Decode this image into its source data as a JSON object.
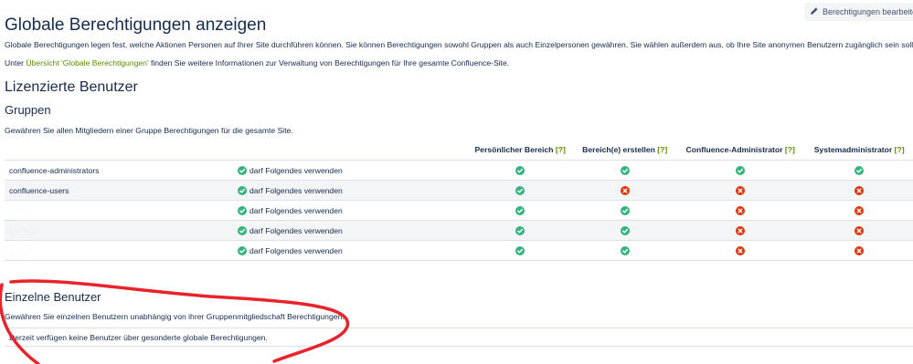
{
  "page": {
    "title": "Globale Berechtigungen anzeigen",
    "edit_button": "Berechtigungen bearbeiten",
    "intro": "Globale Berechtigungen legen fest, welche Aktionen Personen auf Ihrer Site durchführen können. Sie können Berechtigungen sowohl Gruppen als auch Einzelpersonen gewähren. Sie wählen außerdem aus, ob Ihre Site anonymen Benutzern zugänglich sein soll.",
    "intro2_prefix": "Unter ",
    "intro2_link": "Übersicht 'Globale Berechtigungen'",
    "intro2_suffix": " finden Sie weitere Informationen zur Verwaltung von Berechtigungen für Ihre gesamte Confluence-Site."
  },
  "licensed": {
    "heading": "Lizenzierte Benutzer",
    "groups_heading": "Gruppen",
    "groups_desc": "Gewähren Sie allen Mitgliedern einer Gruppe Berechtigungen für die gesamte Site.",
    "columns": [
      {
        "label": "Persönlicher Bereich",
        "help": "[?]"
      },
      {
        "label": "Bereich(e) erstellen",
        "help": "[?]"
      },
      {
        "label": "Confluence-Administrator",
        "help": "[?]"
      },
      {
        "label": "Systemadministrator",
        "help": "[?]"
      }
    ],
    "grant_label": "darf Folgendes verwenden",
    "rows": [
      {
        "name": "confluence-administrators",
        "blurred": false,
        "perms": [
          true,
          true,
          true,
          true
        ]
      },
      {
        "name": "confluence-users",
        "blurred": false,
        "perms": [
          true,
          false,
          false,
          false
        ]
      },
      {
        "name": "·ˌ·ˈ·",
        "blurred": true,
        "perms": [
          true,
          true,
          false,
          false
        ]
      },
      {
        "name": "·ˌ·ˈ··ˌ·ˈ",
        "blurred": true,
        "perms": [
          true,
          true,
          false,
          false
        ]
      },
      {
        "name": "ˌ·ˈ·ˌ",
        "blurred": true,
        "perms": [
          true,
          true,
          false,
          false
        ]
      }
    ]
  },
  "individual": {
    "heading": "Einzelne Benutzer",
    "desc": "Gewähren Sie einzelnen Benutzern unabhängig von ihrer Gruppenmitgliedschaft Berechtigungen.",
    "empty": "Derzeit verfügen keine Benutzer über gesonderte globale Berechtigungen."
  },
  "colors": {
    "yes": "#36b37e",
    "no": "#de350b",
    "link": "#5b8c00",
    "annotation": "#e8232c"
  },
  "icons": {
    "edit": "pencil-icon",
    "yes": "check-circle-icon",
    "no": "cross-circle-icon"
  }
}
